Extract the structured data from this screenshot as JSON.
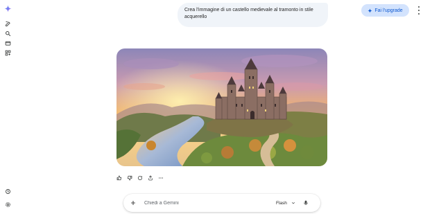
{
  "sidebar": {
    "items": [
      {
        "name": "gemini-logo",
        "icon": "gemini-sparkle-icon"
      },
      {
        "name": "new-chat",
        "icon": "edit-icon"
      },
      {
        "name": "search",
        "icon": "search-icon"
      },
      {
        "name": "library",
        "icon": "folder-icon"
      },
      {
        "name": "gems",
        "icon": "apps-icon"
      },
      {
        "name": "activity",
        "icon": "history-icon"
      },
      {
        "name": "settings",
        "icon": "gear-icon"
      }
    ]
  },
  "header": {
    "upgrade_label": "Fai l'upgrade",
    "upgrade_icon": "sparkle-icon"
  },
  "conversation": {
    "user_prompt": "Crea l'immagine di un castello medievale al tramonto in stile acquerello"
  },
  "response_actions": [
    "thumb-up-icon",
    "thumb-down-icon",
    "regenerate-icon",
    "share-icon",
    "more-icon"
  ],
  "composer": {
    "placeholder": "Chiedi a Gemini",
    "model_label": "Flash"
  },
  "colors": {
    "accent": "#0b57d0",
    "upgrade_bg": "#d3e3fd",
    "bubble_bg": "#f0f4f9"
  }
}
